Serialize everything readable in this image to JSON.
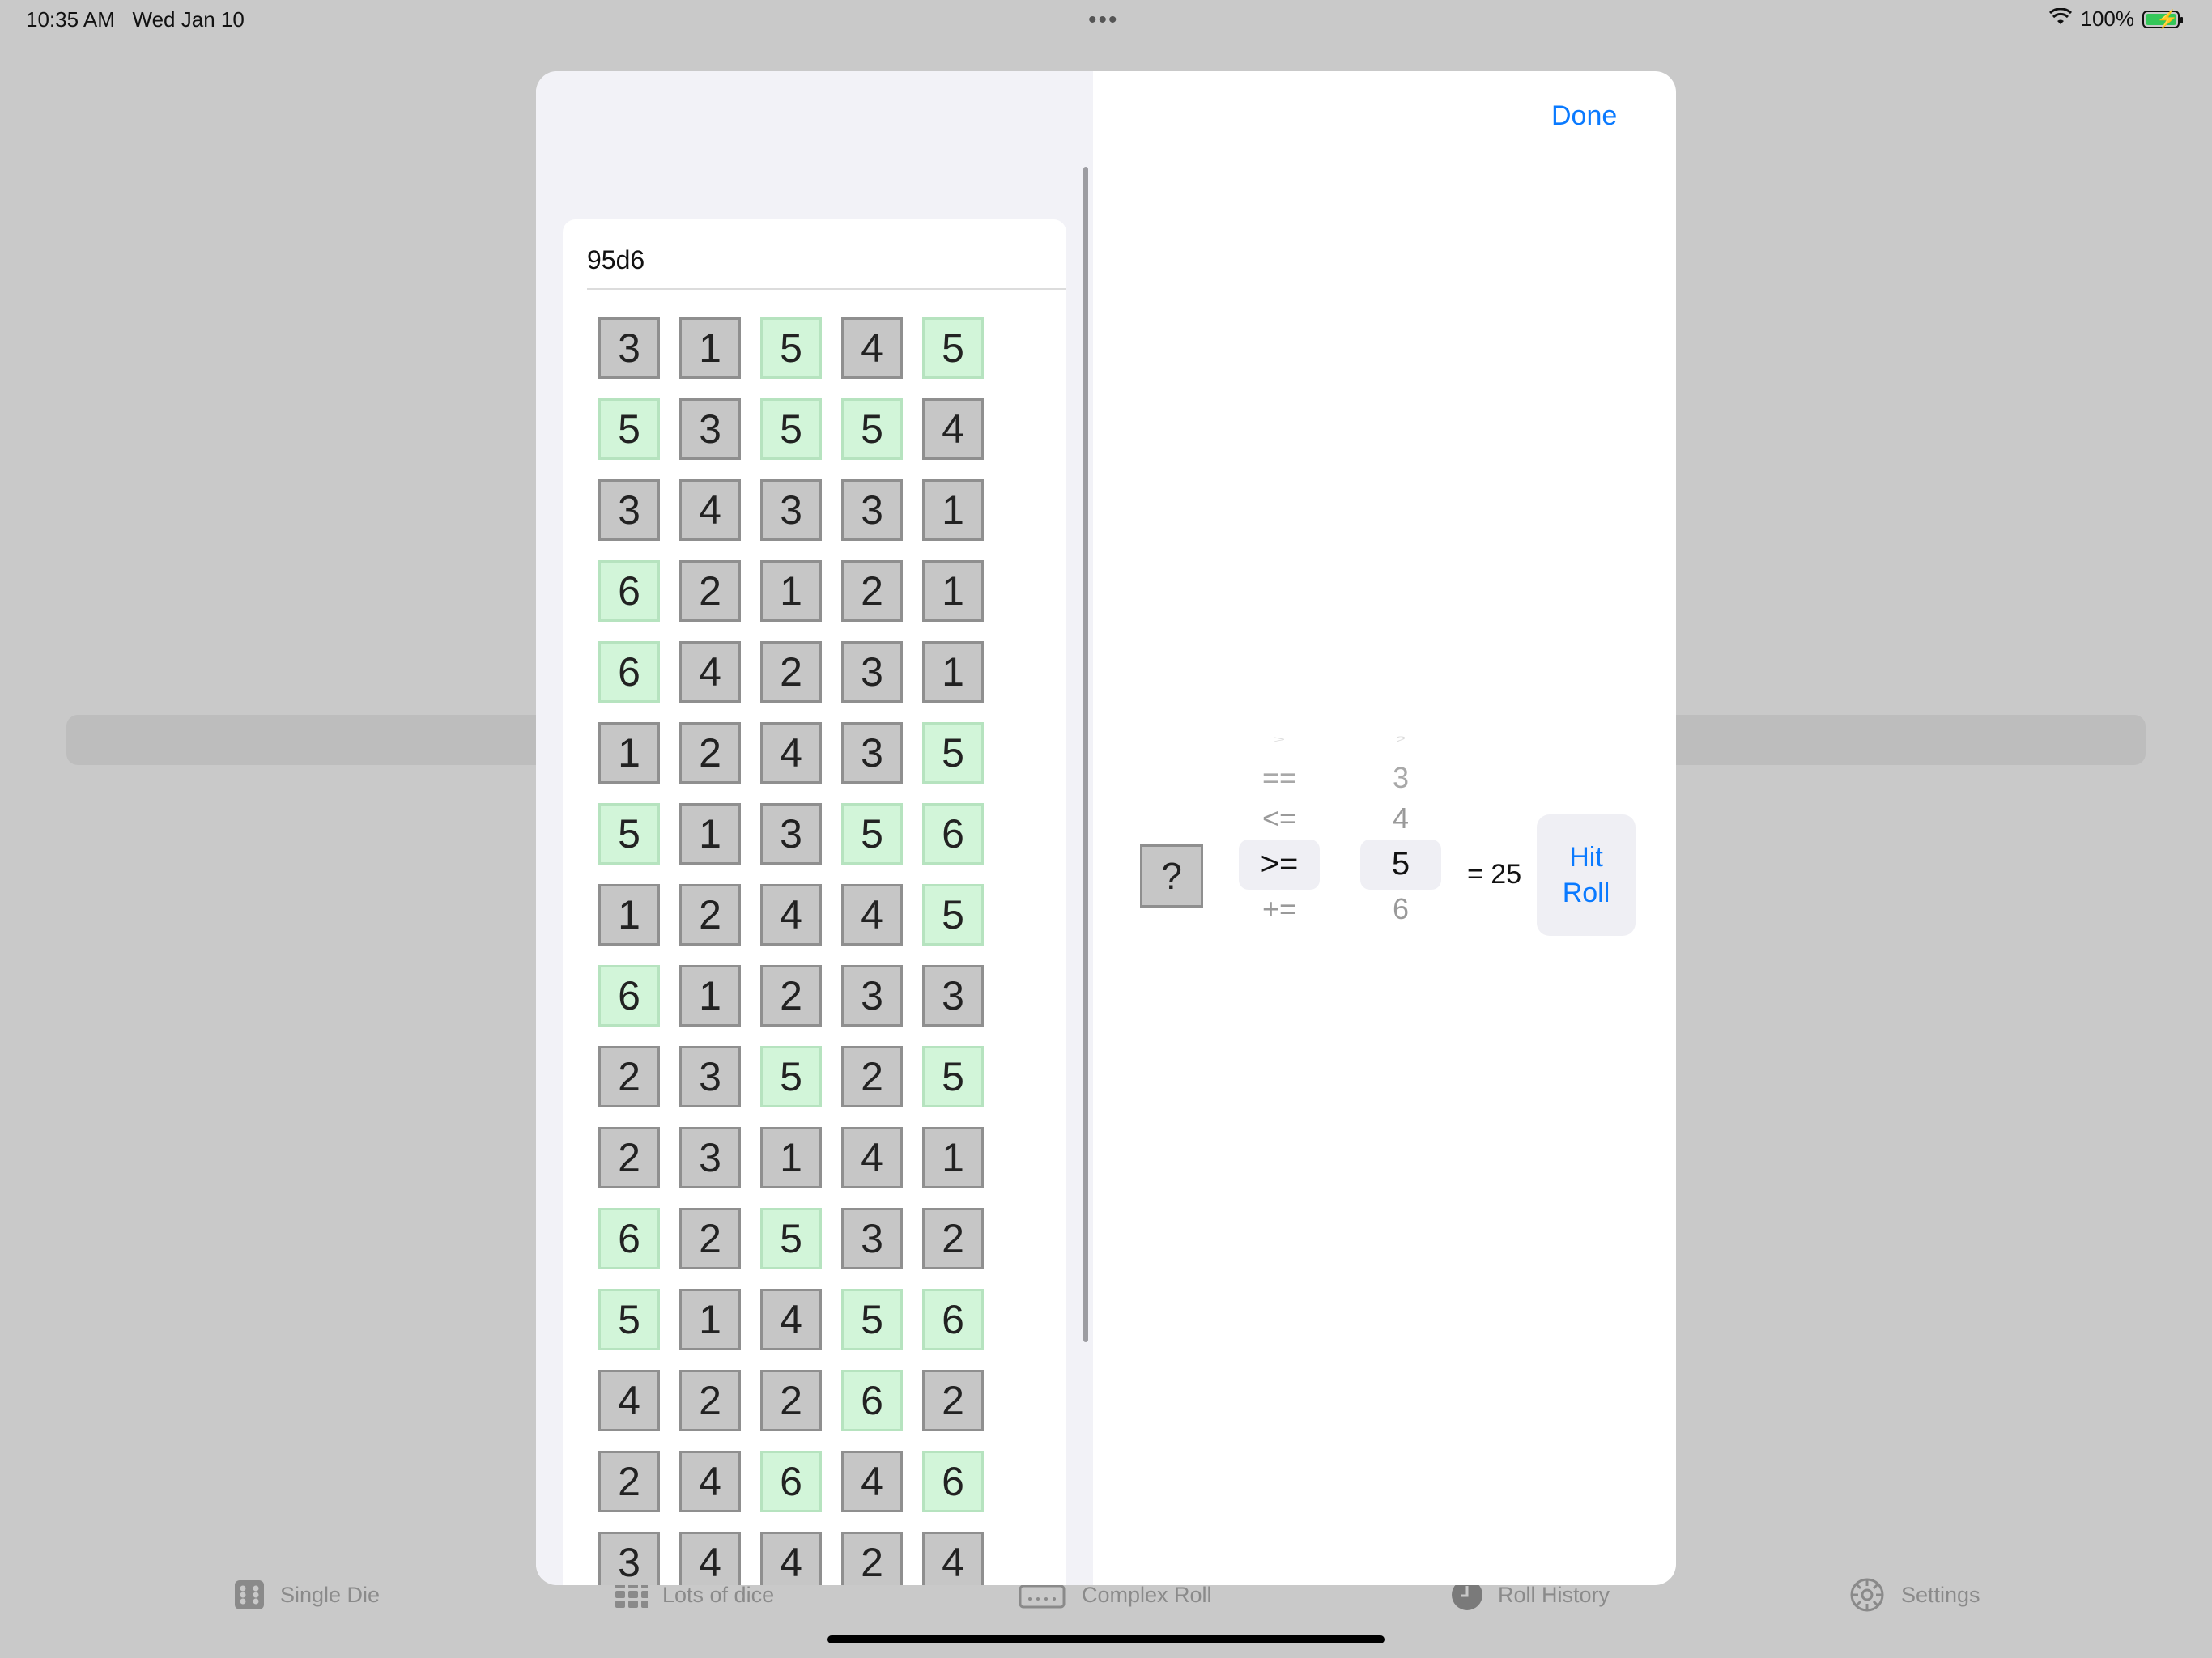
{
  "status_bar": {
    "time": "10:35 AM",
    "date": "Wed Jan 10",
    "battery": "100%",
    "dots": "•••"
  },
  "tabs": [
    {
      "label": "Single Die",
      "icon": "die-icon"
    },
    {
      "label": "Lots of dice",
      "icon": "dice-grid-icon"
    },
    {
      "label": "Complex Roll",
      "icon": "keyboard-icon"
    },
    {
      "label": "Roll History",
      "icon": "clock-icon"
    },
    {
      "label": "Settings",
      "icon": "gear-icon"
    }
  ],
  "modal": {
    "done_label": "Done",
    "roll_title": "95d6",
    "threshold": 5,
    "dice_rows": [
      [
        3,
        1,
        5,
        4,
        5
      ],
      [
        5,
        3,
        5,
        5,
        4
      ],
      [
        3,
        4,
        3,
        3,
        1
      ],
      [
        6,
        2,
        1,
        2,
        1
      ],
      [
        6,
        4,
        2,
        3,
        1
      ],
      [
        1,
        2,
        4,
        3,
        5
      ],
      [
        5,
        1,
        3,
        5,
        6
      ],
      [
        1,
        2,
        4,
        4,
        5
      ],
      [
        6,
        1,
        2,
        3,
        3
      ],
      [
        2,
        3,
        5,
        2,
        5
      ],
      [
        2,
        3,
        1,
        4,
        1
      ],
      [
        6,
        2,
        5,
        3,
        2
      ],
      [
        5,
        1,
        4,
        5,
        6
      ],
      [
        4,
        2,
        2,
        6,
        2
      ],
      [
        2,
        4,
        6,
        4,
        6
      ],
      [
        3,
        4,
        4,
        2,
        4
      ]
    ],
    "controls": {
      "placeholder_die": "?",
      "operator_options": [
        ">",
        "==",
        "<=",
        ">=",
        "+="
      ],
      "operator_selected": ">=",
      "value_options": [
        "2",
        "3",
        "4",
        "5",
        "6"
      ],
      "value_selected": "5",
      "result": "= 25",
      "hit_roll_line1": "Hit",
      "hit_roll_line2": "Roll"
    }
  }
}
